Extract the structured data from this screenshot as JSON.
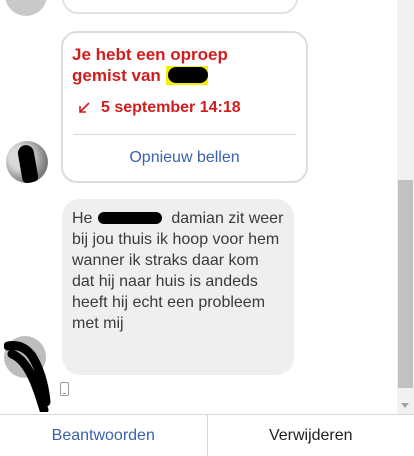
{
  "missed_call": {
    "title_line1": "Je hebt een oproep",
    "title_line2": "gemist van",
    "timestamp": "5 september 14:18",
    "callback_label": "Opnieuw bellen",
    "icon": "missed-call-arrow-icon"
  },
  "message": {
    "lead": "He",
    "text": "damian zit weer bij jou thuis ik hoop voor hem wanner ik straks daar kom dat hij naar huis is andeds heeft hij echt een probleem met mij",
    "device_icon": "phone-icon"
  },
  "actions": {
    "reply_label": "Beantwoorden",
    "delete_label": "Verwijderen"
  },
  "colors": {
    "missed_red": "#d11d1d",
    "link_blue": "#3b62a8",
    "bubble_gray": "#efefef"
  }
}
